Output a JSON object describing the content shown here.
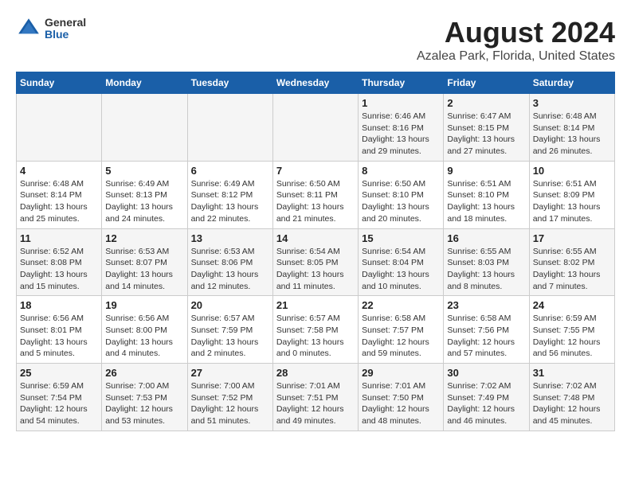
{
  "header": {
    "logo": {
      "general": "General",
      "blue": "Blue"
    },
    "title": "August 2024",
    "subtitle": "Azalea Park, Florida, United States"
  },
  "days_of_week": [
    "Sunday",
    "Monday",
    "Tuesday",
    "Wednesday",
    "Thursday",
    "Friday",
    "Saturday"
  ],
  "weeks": [
    [
      {
        "day": "",
        "info": ""
      },
      {
        "day": "",
        "info": ""
      },
      {
        "day": "",
        "info": ""
      },
      {
        "day": "",
        "info": ""
      },
      {
        "day": "1",
        "info": "Sunrise: 6:46 AM\nSunset: 8:16 PM\nDaylight: 13 hours\nand 29 minutes."
      },
      {
        "day": "2",
        "info": "Sunrise: 6:47 AM\nSunset: 8:15 PM\nDaylight: 13 hours\nand 27 minutes."
      },
      {
        "day": "3",
        "info": "Sunrise: 6:48 AM\nSunset: 8:14 PM\nDaylight: 13 hours\nand 26 minutes."
      }
    ],
    [
      {
        "day": "4",
        "info": "Sunrise: 6:48 AM\nSunset: 8:14 PM\nDaylight: 13 hours\nand 25 minutes."
      },
      {
        "day": "5",
        "info": "Sunrise: 6:49 AM\nSunset: 8:13 PM\nDaylight: 13 hours\nand 24 minutes."
      },
      {
        "day": "6",
        "info": "Sunrise: 6:49 AM\nSunset: 8:12 PM\nDaylight: 13 hours\nand 22 minutes."
      },
      {
        "day": "7",
        "info": "Sunrise: 6:50 AM\nSunset: 8:11 PM\nDaylight: 13 hours\nand 21 minutes."
      },
      {
        "day": "8",
        "info": "Sunrise: 6:50 AM\nSunset: 8:10 PM\nDaylight: 13 hours\nand 20 minutes."
      },
      {
        "day": "9",
        "info": "Sunrise: 6:51 AM\nSunset: 8:10 PM\nDaylight: 13 hours\nand 18 minutes."
      },
      {
        "day": "10",
        "info": "Sunrise: 6:51 AM\nSunset: 8:09 PM\nDaylight: 13 hours\nand 17 minutes."
      }
    ],
    [
      {
        "day": "11",
        "info": "Sunrise: 6:52 AM\nSunset: 8:08 PM\nDaylight: 13 hours\nand 15 minutes."
      },
      {
        "day": "12",
        "info": "Sunrise: 6:53 AM\nSunset: 8:07 PM\nDaylight: 13 hours\nand 14 minutes."
      },
      {
        "day": "13",
        "info": "Sunrise: 6:53 AM\nSunset: 8:06 PM\nDaylight: 13 hours\nand 12 minutes."
      },
      {
        "day": "14",
        "info": "Sunrise: 6:54 AM\nSunset: 8:05 PM\nDaylight: 13 hours\nand 11 minutes."
      },
      {
        "day": "15",
        "info": "Sunrise: 6:54 AM\nSunset: 8:04 PM\nDaylight: 13 hours\nand 10 minutes."
      },
      {
        "day": "16",
        "info": "Sunrise: 6:55 AM\nSunset: 8:03 PM\nDaylight: 13 hours\nand 8 minutes."
      },
      {
        "day": "17",
        "info": "Sunrise: 6:55 AM\nSunset: 8:02 PM\nDaylight: 13 hours\nand 7 minutes."
      }
    ],
    [
      {
        "day": "18",
        "info": "Sunrise: 6:56 AM\nSunset: 8:01 PM\nDaylight: 13 hours\nand 5 minutes."
      },
      {
        "day": "19",
        "info": "Sunrise: 6:56 AM\nSunset: 8:00 PM\nDaylight: 13 hours\nand 4 minutes."
      },
      {
        "day": "20",
        "info": "Sunrise: 6:57 AM\nSunset: 7:59 PM\nDaylight: 13 hours\nand 2 minutes."
      },
      {
        "day": "21",
        "info": "Sunrise: 6:57 AM\nSunset: 7:58 PM\nDaylight: 13 hours\nand 0 minutes."
      },
      {
        "day": "22",
        "info": "Sunrise: 6:58 AM\nSunset: 7:57 PM\nDaylight: 12 hours\nand 59 minutes."
      },
      {
        "day": "23",
        "info": "Sunrise: 6:58 AM\nSunset: 7:56 PM\nDaylight: 12 hours\nand 57 minutes."
      },
      {
        "day": "24",
        "info": "Sunrise: 6:59 AM\nSunset: 7:55 PM\nDaylight: 12 hours\nand 56 minutes."
      }
    ],
    [
      {
        "day": "25",
        "info": "Sunrise: 6:59 AM\nSunset: 7:54 PM\nDaylight: 12 hours\nand 54 minutes."
      },
      {
        "day": "26",
        "info": "Sunrise: 7:00 AM\nSunset: 7:53 PM\nDaylight: 12 hours\nand 53 minutes."
      },
      {
        "day": "27",
        "info": "Sunrise: 7:00 AM\nSunset: 7:52 PM\nDaylight: 12 hours\nand 51 minutes."
      },
      {
        "day": "28",
        "info": "Sunrise: 7:01 AM\nSunset: 7:51 PM\nDaylight: 12 hours\nand 49 minutes."
      },
      {
        "day": "29",
        "info": "Sunrise: 7:01 AM\nSunset: 7:50 PM\nDaylight: 12 hours\nand 48 minutes."
      },
      {
        "day": "30",
        "info": "Sunrise: 7:02 AM\nSunset: 7:49 PM\nDaylight: 12 hours\nand 46 minutes."
      },
      {
        "day": "31",
        "info": "Sunrise: 7:02 AM\nSunset: 7:48 PM\nDaylight: 12 hours\nand 45 minutes."
      }
    ]
  ]
}
